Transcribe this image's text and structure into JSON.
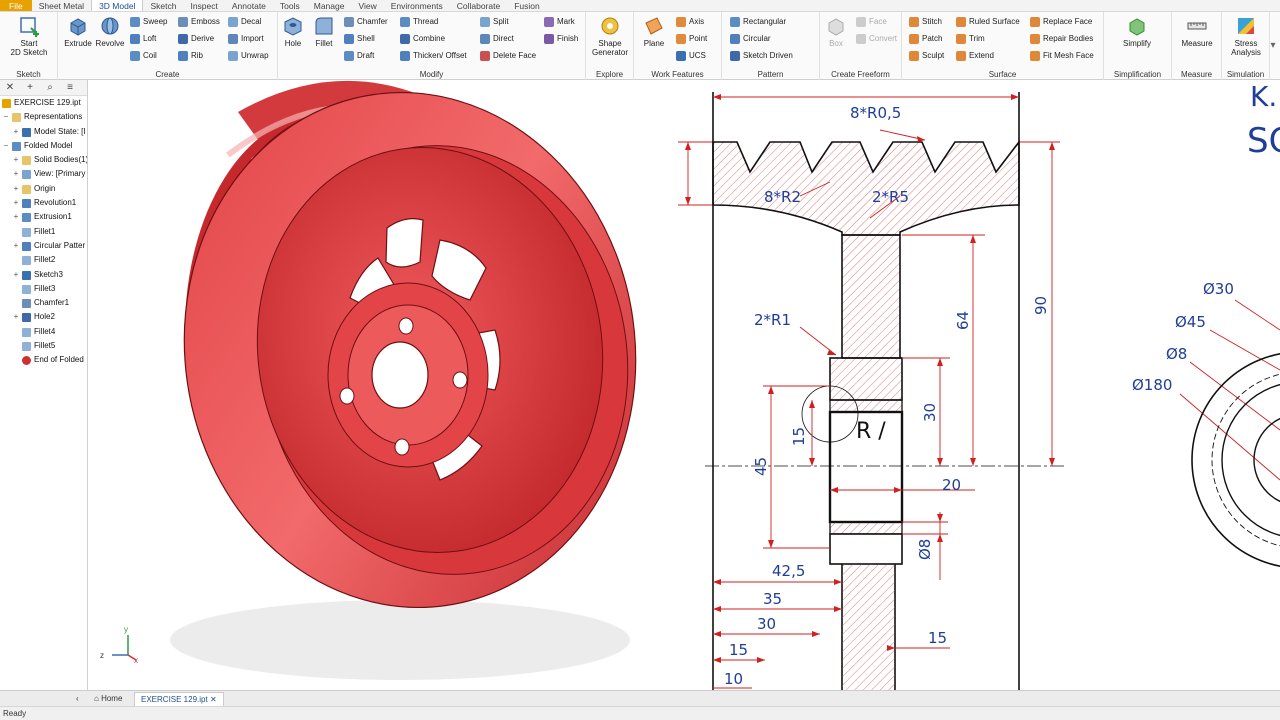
{
  "menu": {
    "tabs": [
      "File",
      "Sheet Metal",
      "3D Model",
      "Sketch",
      "Inspect",
      "Annotate",
      "Tools",
      "Manage",
      "View",
      "Environments",
      "Collaborate",
      "Fusion"
    ]
  },
  "ribbon": {
    "sketch": {
      "label": "Sketch",
      "start_line1": "Start",
      "start_line2": "2D Sketch"
    },
    "create": {
      "label": "Create",
      "extrude": "Extrude",
      "revolve": "Revolve",
      "sweep": "Sweep",
      "emboss": "Emboss",
      "decal": "Decal",
      "loft": "Loft",
      "derive": "Derive",
      "import": "Import",
      "coil": "Coil",
      "rib": "Rib",
      "unwrap": "Unwrap"
    },
    "modify": {
      "label": "Modify",
      "hole": "Hole",
      "fillet": "Fillet",
      "chamfer": "Chamfer",
      "thread": "Thread",
      "split": "Split",
      "shell": "Shell",
      "combine": "Combine",
      "direct": "Direct",
      "draft": "Draft",
      "thicken": "Thicken/ Offset",
      "delete_face": "Delete Face"
    },
    "explore": {
      "label": "Explore",
      "mark": "Mark",
      "finish": "Finish",
      "shape_gen_line1": "Shape",
      "shape_gen_line2": "Generator"
    },
    "work_features": {
      "label": "Work Features",
      "plane": "Plane",
      "axis": "Axis",
      "point": "Point",
      "ucs": "UCS"
    },
    "pattern": {
      "label": "Pattern",
      "rectangular": "Rectangular",
      "circular": "Circular",
      "sketch_driven": "Sketch Driven"
    },
    "freeform": {
      "label": "Create Freeform",
      "box": "Box",
      "face": "Face",
      "convert": "Convert"
    },
    "surface": {
      "label": "Surface",
      "stitch": "Stitch",
      "ruled": "Ruled Surface",
      "replace_face": "Replace Face",
      "patch": "Patch",
      "trim": "Trim",
      "repair": "Repair Bodies",
      "sculpt": "Sculpt",
      "extend": "Extend",
      "fit_mesh": "Fit Mesh Face"
    },
    "simplification": {
      "label": "Simplification",
      "simplify": "Simplify"
    },
    "measure": {
      "label": "Measure",
      "measure": "Measure"
    },
    "simulation": {
      "label": "Simulation",
      "stress_line1": "Stress",
      "stress_line2": "Analysis"
    }
  },
  "browser": {
    "items": [
      {
        "label": "EXERCISE 129.ipt",
        "icon": "part-icon",
        "exp": ""
      },
      {
        "label": "Representations",
        "icon": "folder-icon",
        "exp": "−"
      },
      {
        "label": "Model State: [I",
        "icon": "model-state-icon",
        "exp": "+"
      },
      {
        "label": "Folded Model",
        "icon": "folded-model-icon",
        "exp": "−"
      },
      {
        "label": "Solid Bodies(1)",
        "icon": "folder-icon",
        "exp": "+"
      },
      {
        "label": "View: [Primary",
        "icon": "view-icon",
        "exp": "+"
      },
      {
        "label": "Origin",
        "icon": "folder-icon",
        "exp": "+"
      },
      {
        "label": "Revolution1",
        "icon": "revolve-icon",
        "exp": "+"
      },
      {
        "label": "Extrusion1",
        "icon": "extrude-icon",
        "exp": "+"
      },
      {
        "label": "Fillet1",
        "icon": "fillet-icon",
        "exp": ""
      },
      {
        "label": "Circular Patter",
        "icon": "circular-pattern-icon",
        "exp": "+"
      },
      {
        "label": "Fillet2",
        "icon": "fillet-icon",
        "exp": ""
      },
      {
        "label": "Sketch3",
        "icon": "sketch-icon",
        "exp": "+"
      },
      {
        "label": "Fillet3",
        "icon": "fillet-icon",
        "exp": ""
      },
      {
        "label": "Chamfer1",
        "icon": "chamfer-icon",
        "exp": ""
      },
      {
        "label": "Hole2",
        "icon": "hole-icon",
        "exp": "+"
      },
      {
        "label": "Fillet4",
        "icon": "fillet-icon",
        "exp": ""
      },
      {
        "label": "Fillet5",
        "icon": "fillet-icon",
        "exp": ""
      },
      {
        "label": "End of Folded",
        "icon": "end-of-part-icon",
        "exp": ""
      }
    ]
  },
  "drawing": {
    "dims": {
      "top": "8*R0,5",
      "r2": "8*R2",
      "r5": "2*R5",
      "r1": "2*R1",
      "d64": "64",
      "d90": "90",
      "d30v": "30",
      "d15v": "15",
      "d45": "45",
      "d20": "20",
      "d8": "Ø8",
      "d42_5": "42,5",
      "d35": "35",
      "d30h": "30",
      "d15h": "15",
      "d15r": "15",
      "d10": "10",
      "rr": "R /",
      "dia30": "Ø30",
      "dia45": "Ø45",
      "dia8": "Ø8",
      "dia180": "Ø180"
    },
    "title_fragment_1": "K.",
    "title_fragment_2": "SC"
  },
  "triad": {
    "y": "y",
    "z": "z",
    "x": "x"
  },
  "doc_tabs": {
    "home": "Home",
    "active": "EXERCISE 129.ipt"
  },
  "status": {
    "text": "Ready"
  },
  "colors": {
    "part_red": "#e8484b",
    "hatch": "#d04040",
    "dimension_blue": "#1f3d99",
    "accent": "#1b4f91"
  }
}
